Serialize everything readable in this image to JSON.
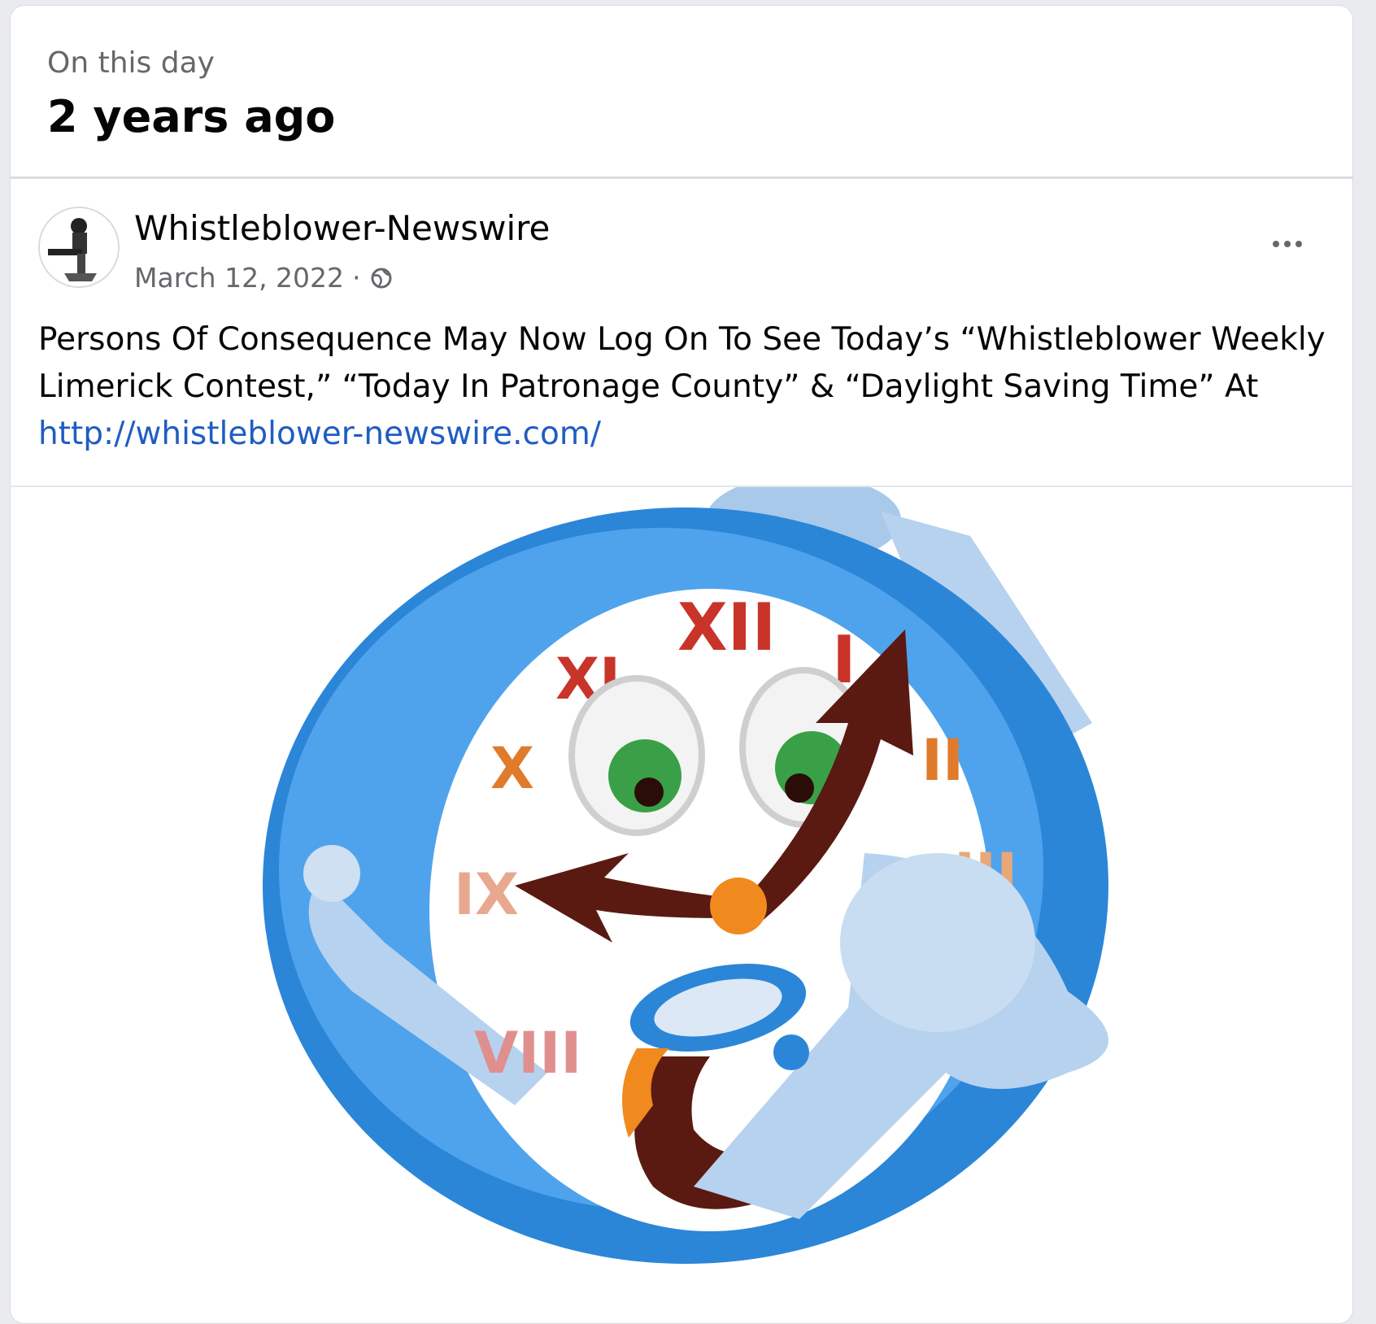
{
  "memory": {
    "kicker": "On this day",
    "years_ago": "2 years ago"
  },
  "post": {
    "author": "Whistleblower-Newswire",
    "date": "March 12, 2022",
    "separator": "·",
    "privacy_icon": "globe-icon",
    "more_icon": "more-options-icon",
    "text_before_link": "Persons Of Consequence May Now Log On To See Today’s “Whistleblower Weekly Limerick Contest,” “Today In Patronage County” & “Daylight Saving Time”  At ",
    "link": "http://whistleblower-newswire.com/"
  },
  "image": {
    "numerals": [
      "XII",
      "I",
      "II",
      "III",
      "VIII",
      "IX",
      "X",
      "XI"
    ]
  },
  "colors": {
    "link": "#1f5dc2",
    "clock_ring": "#2b86d8",
    "numerals_red": "#c9342a",
    "numerals_orange": "#e07b2c",
    "hands": "#5a1a12"
  }
}
